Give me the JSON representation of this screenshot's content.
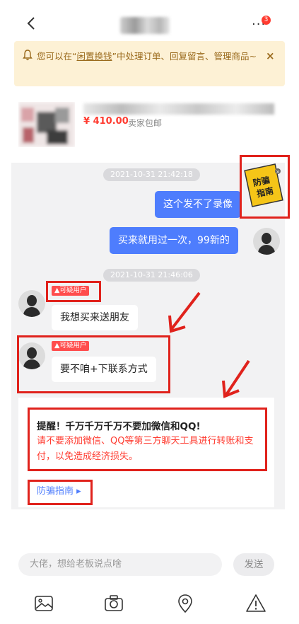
{
  "header": {
    "unread_count": "3"
  },
  "notice": {
    "text_prefix": "您可以在“",
    "link": "闲置换钱",
    "text_suffix": "”中处理订单、回复留言、管理商品~",
    "close": "×"
  },
  "product": {
    "price": "¥ 410.00",
    "shipping": "卖家包邮"
  },
  "chat": {
    "timestamps": [
      "2021-10-31 21:42:18",
      "2021-10-31 21:46:06"
    ],
    "messages": [
      {
        "side": "right",
        "text": "这个发不了录像"
      },
      {
        "side": "right",
        "text": "买来就用过一次，99新的"
      },
      {
        "side": "left",
        "tag": "可疑用户",
        "text": "我想买来送朋友"
      },
      {
        "side": "left",
        "tag": "可疑用户",
        "text": "要不咱+下联系方式"
      }
    ],
    "sticker_text": [
      "防骗",
      "指南"
    ]
  },
  "warning": {
    "title": "提醒！千万千万千万不要加微信和QQ!",
    "body": "请不要添加微信、QQ等第三方聊天工具进行转账和支付，以免造成经济损失。",
    "guide_link": "防骗指南 ▸"
  },
  "composer": {
    "placeholder": "大佬，想给老板说点啥",
    "send": "发送"
  },
  "toolbar": {
    "icons": [
      "image-icon",
      "camera-icon",
      "location-icon",
      "warning-icon"
    ]
  },
  "colors": {
    "accent_blue": "#4e7dfd",
    "alert_red": "#ff3b30",
    "annotation_red": "#e0221c",
    "notice_bg": "#fdf1d5"
  }
}
